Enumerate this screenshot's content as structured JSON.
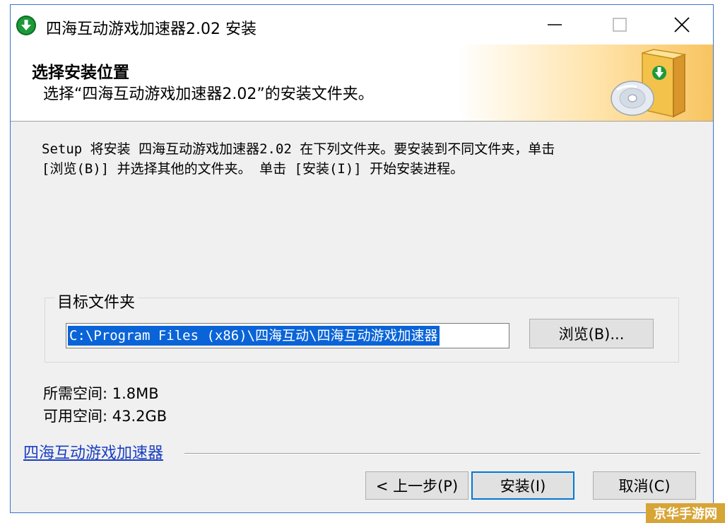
{
  "window": {
    "title": "四海互动游戏加速器2.02 安装"
  },
  "header": {
    "title": "选择安装位置",
    "subtitle": "选择“四海互动游戏加速器2.02”的安装文件夹。"
  },
  "body": {
    "intro_line1": "Setup 将安装 四海互动游戏加速器2.02 在下列文件夹。要安装到不同文件夹，单击",
    "intro_line2": "[浏览(B)] 并选择其他的文件夹。 单击 [安装(I)] 开始安装进程。"
  },
  "destination": {
    "legend": "目标文件夹",
    "path_value": "C:\\Program Files (x86)\\四海互动\\四海互动游戏加速器",
    "browse_label": "浏览(B)..."
  },
  "space": {
    "required": "所需空间: 1.8MB",
    "available": "可用空间: 43.2GB"
  },
  "footer": {
    "brand_link": "四海互动游戏加速器",
    "back_label": "< 上一步(P)",
    "install_label": "安装(I)",
    "cancel_label": "取消(C)"
  },
  "watermark": {
    "text": "京华手游网"
  },
  "colors": {
    "accent": "#0078d7",
    "selection": "#0a64d8",
    "link": "#1a3fc1",
    "app_icon": "#1c9a3a"
  },
  "icons": {
    "app": "download-arrow-icon",
    "minimize": "minimize-icon",
    "maximize": "maximize-icon",
    "close": "close-icon",
    "header": "installer-disc-box-icon"
  }
}
